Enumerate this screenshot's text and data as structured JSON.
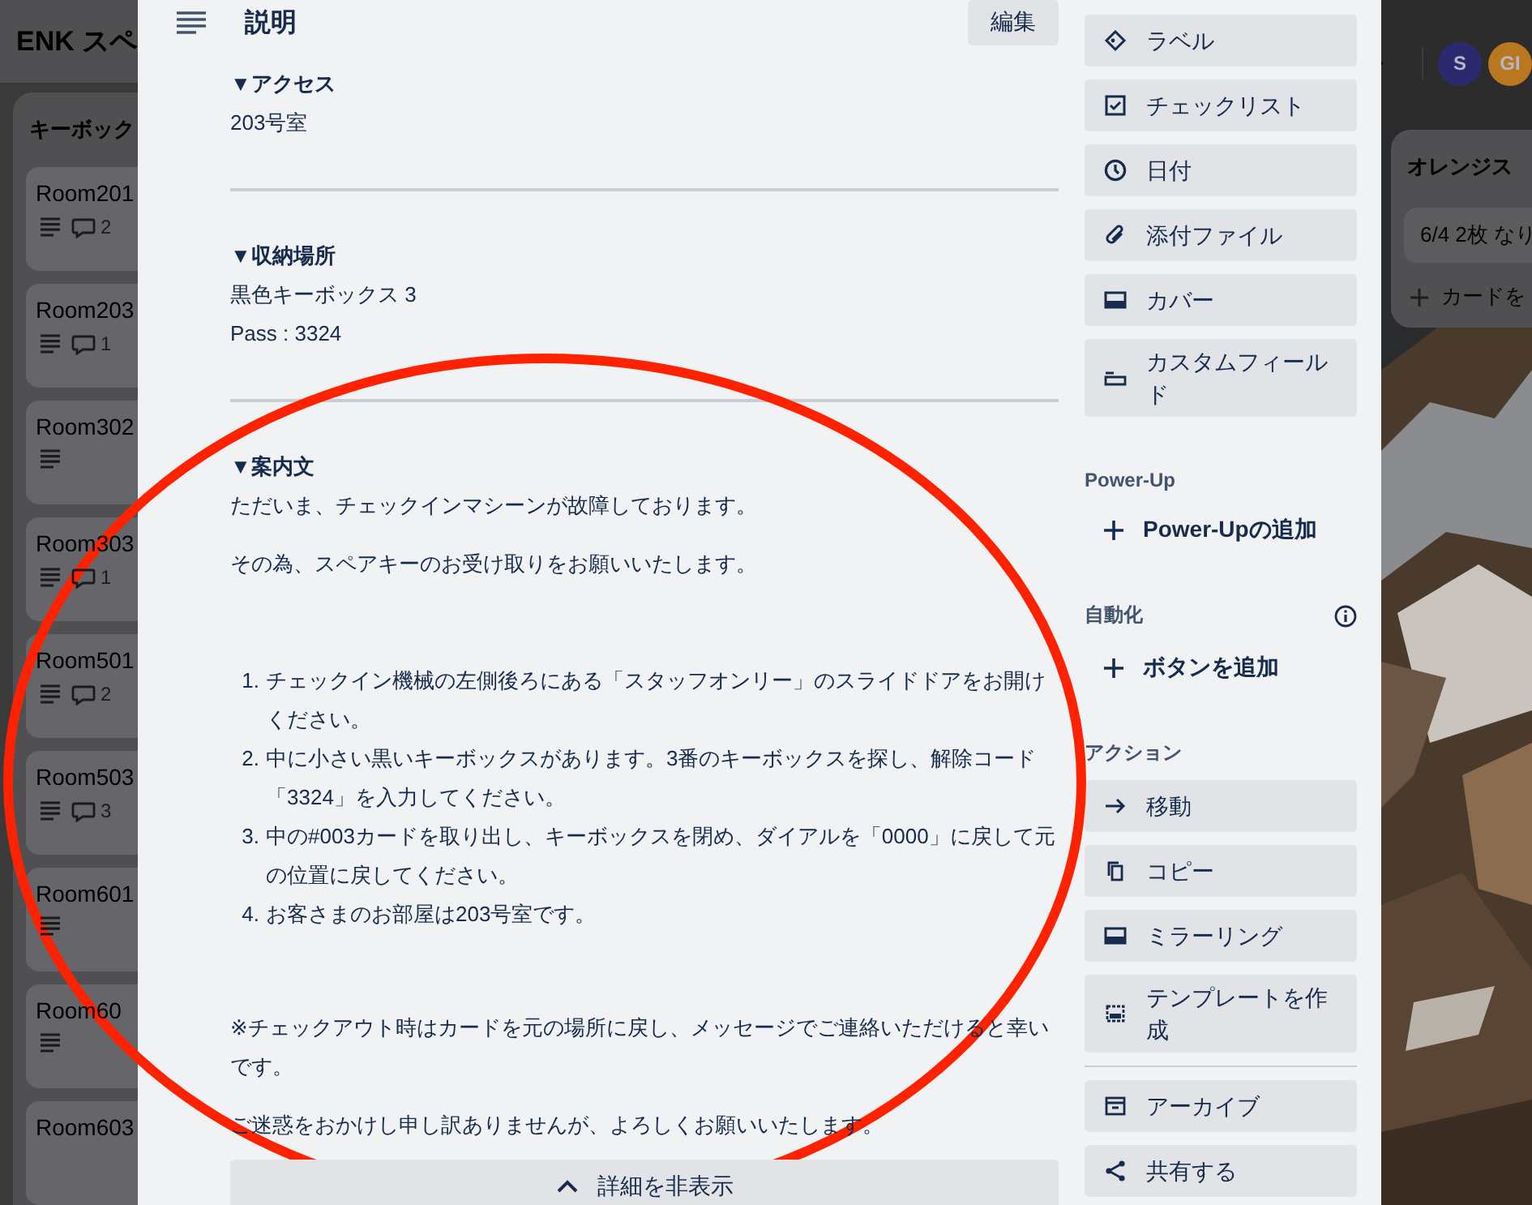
{
  "board": {
    "title": "ENK スペ",
    "left_list": {
      "title": "キーボック",
      "cards": [
        {
          "title": "Room201",
          "description": true,
          "comments": "2"
        },
        {
          "title": "Room203",
          "description": true,
          "comments": "1"
        },
        {
          "title": "Room302",
          "description": true
        },
        {
          "title": "Room303",
          "description": true,
          "comments": "1"
        },
        {
          "title": "Room501",
          "description": true,
          "comments": "2"
        },
        {
          "title": "Room503",
          "description": true,
          "comments": "3"
        },
        {
          "title": "Room601",
          "description": true
        },
        {
          "title": "Room60",
          "description": true
        },
        {
          "title": "Room603"
        }
      ]
    },
    "members": [
      {
        "initial": "S",
        "color": "#2b2a6e"
      },
      {
        "initial": "GI",
        "color": "#b9771f"
      }
    ],
    "right_list": {
      "title": "オレンジス",
      "cards": [
        "6/4 2枚 なり"
      ],
      "add_card": "カードを"
    }
  },
  "card_modal": {
    "description": {
      "heading": "説明",
      "edit_button": "編集",
      "sections": [
        {
          "heading": "▼アクセス",
          "lines": [
            "203号室"
          ]
        },
        {
          "heading": "▼収納場所",
          "lines": [
            "黒色キーボックス 3",
            "Pass : 3324"
          ]
        }
      ],
      "guide": {
        "heading": "▼案内文",
        "intro": [
          "ただいま、チェックインマシーンが故障しております。",
          "その為、スペアキーのお受け取りをお願いいたします。"
        ],
        "steps": [
          {
            "number": "1.",
            "text": "チェックイン機械の左側後ろにある「スタッフオンリー」のスライドドアをお開けください。"
          },
          {
            "number": "2.",
            "text": "中に小さい黒いキーボックスがあります。3番のキーボックスを探し、解除コード「3324」を入力してください。"
          },
          {
            "number": "3.",
            "text": "中の#003カードを取り出し、キーボックスを閉め、ダイアルを「0000」に戻して元の位置に戻してください。"
          },
          {
            "number": "4.",
            "text": "お客さまのお部屋は203号室です。"
          }
        ],
        "notes": [
          "※チェックアウト時はカードを元の場所に戻し、メッセージでご連絡いただけると幸いです。",
          "ご迷惑をおかけし申し訳ありませんが、よろしくお願いいたします。"
        ]
      },
      "collapse_button": "詳細を非表示"
    },
    "sidebar": {
      "add_items": [
        "ラベル",
        "チェックリスト",
        "日付",
        "添付ファイル",
        "カバー",
        "カスタムフィールド"
      ],
      "power_up": {
        "heading": "Power-Up",
        "add_label": "Power-Upの追加"
      },
      "automation": {
        "heading": "自動化",
        "add_label": "ボタンを追加"
      },
      "actions": {
        "heading": "アクション",
        "items": [
          "移動",
          "コピー",
          "ミラーリング",
          "テンプレートを作成"
        ],
        "more_items": [
          "アーカイブ",
          "共有する"
        ]
      }
    }
  }
}
